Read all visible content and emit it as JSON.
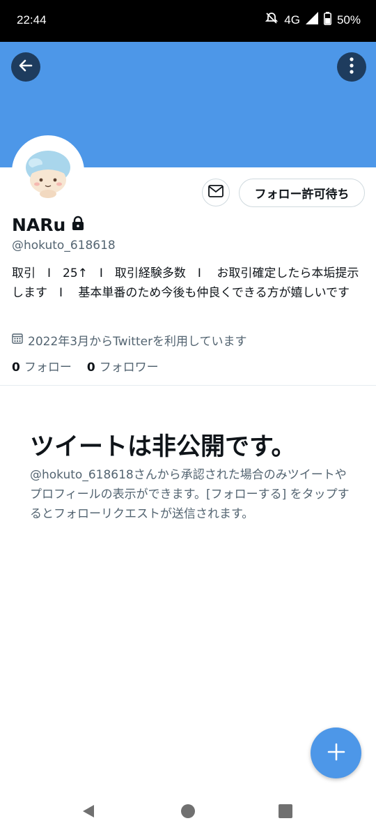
{
  "status_bar": {
    "time": "22:44",
    "network": "4G",
    "battery": "50%"
  },
  "header": {
    "back_icon": "arrow-left-icon",
    "more_icon": "more-vertical-icon",
    "banner_color": "#4d97e8"
  },
  "profile": {
    "avatar_icon": "cartoon-avatar",
    "follow_button_label": "フォロー許可待ち",
    "name": "NARu",
    "lock_icon": "lock-icon",
    "handle": "@hokuto_618618",
    "bio": "取引　I　25↑　I　取引経験多数　I　 お取引確定したら本垢提示します　I　 基本単番のため今後も仲良くできる方が嬉しいです",
    "joined_icon": "calendar-icon",
    "joined": "2022年3月からTwitterを利用しています",
    "following_count": "0",
    "following_label": "フォロー",
    "followers_count": "0",
    "followers_label": "フォロワー"
  },
  "private_notice": {
    "title": "ツイートは非公開です。",
    "description": "@hokuto_618618さんから承認された場合のみツイートやプロフィールの表示ができます。[フォローする] をタップするとフォローリクエストが送信されます。"
  },
  "fab": {
    "icon": "plus-icon",
    "color": "#4d97e8"
  },
  "nav": {
    "back": "triangle-back-icon",
    "home": "circle-home-icon",
    "recents": "square-recents-icon"
  }
}
